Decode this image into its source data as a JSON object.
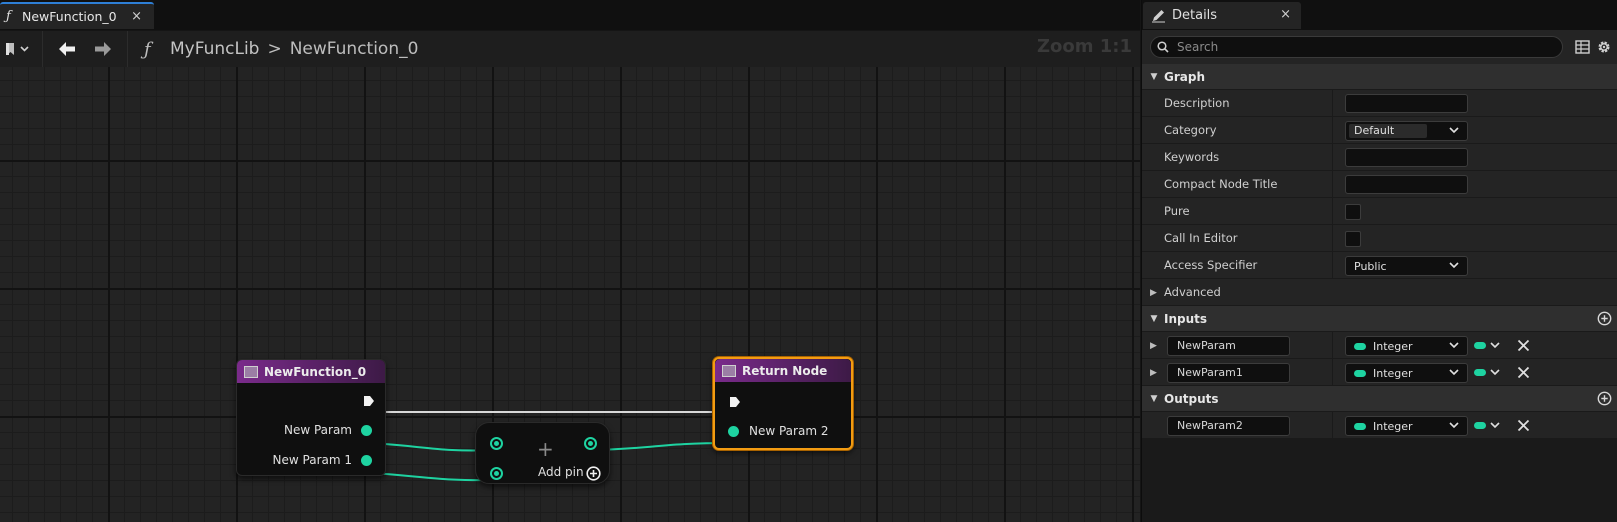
{
  "editor_tab": {
    "label": "NewFunction_0",
    "close": "×"
  },
  "breadcrumb": {
    "library": "MyFuncLib",
    "separator": ">",
    "function": "NewFunction_0"
  },
  "zoom_label": "Zoom 1:1",
  "graph": {
    "entry_node": {
      "title": "NewFunction_0",
      "pins": [
        "New Param",
        "New Param 1"
      ]
    },
    "add_node": {
      "label": "Add pin",
      "plus": "+"
    },
    "return_node": {
      "title": "Return Node",
      "pins": [
        "New Param 2"
      ]
    },
    "pin_color": "#1ed3a1",
    "function_header_color": "#7a2b8b",
    "selection_color": "#f39c12"
  },
  "details": {
    "tab_label": "Details",
    "close": "×",
    "search_placeholder": "Search",
    "graph_section": {
      "label": "Graph",
      "rows": {
        "description": "Description",
        "category": "Category",
        "category_value": "Default",
        "keywords": "Keywords",
        "compact_node_title": "Compact Node Title",
        "pure": "Pure",
        "call_in_editor": "Call In Editor",
        "access_specifier": "Access Specifier",
        "access_value": "Public",
        "advanced": "Advanced"
      }
    },
    "inputs_section": {
      "label": "Inputs",
      "params": [
        {
          "name": "NewParam",
          "type": "Integer"
        },
        {
          "name": "NewParam1",
          "type": "Integer"
        }
      ]
    },
    "outputs_section": {
      "label": "Outputs",
      "params": [
        {
          "name": "NewParam2",
          "type": "Integer"
        }
      ]
    }
  }
}
